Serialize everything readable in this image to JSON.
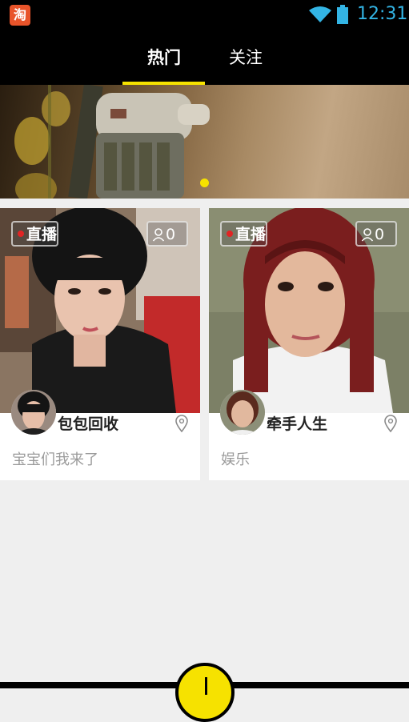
{
  "status_bar": {
    "app_icon_glyph": "淘",
    "app_icon_color": "#e8542a",
    "wifi_icon": "wifi-icon",
    "battery_icon": "battery-icon",
    "time": "12:31",
    "accent": "#33b5e5"
  },
  "top_nav": {
    "tabs": [
      {
        "label": "热门",
        "active": true
      },
      {
        "label": "关注",
        "active": false
      }
    ],
    "indicator_color": "#f6e200"
  },
  "banner": {
    "page_indicator_count": 1,
    "page_indicator_color": "#f6e200"
  },
  "cards": [
    {
      "live_label": "直播",
      "viewer_count": "0",
      "name": "包包回收",
      "description": "宝宝们我来了",
      "location_icon": "location-pin-icon"
    },
    {
      "live_label": "直播",
      "viewer_count": "0",
      "name": "牵手人生",
      "description": "娱乐",
      "location_icon": "location-pin-icon"
    }
  ],
  "bottom": {
    "fab_color": "#f6e200",
    "fab_icon": "live-start-icon"
  }
}
